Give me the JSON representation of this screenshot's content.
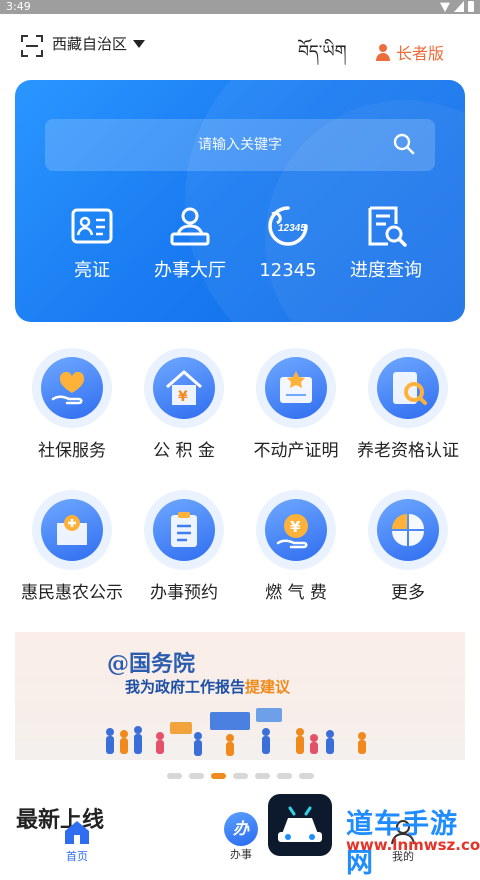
{
  "status_bar": {
    "time": "3:49"
  },
  "header": {
    "region": "西藏自治区",
    "tibetan_label": "བོད་ཡིག",
    "elder_mode": "长者版"
  },
  "search": {
    "placeholder": "请输入关键字"
  },
  "quick_actions": [
    {
      "label": "亮证",
      "icon": "id-card-icon"
    },
    {
      "label": "办事大厅",
      "icon": "service-hall-icon"
    },
    {
      "label": "12345",
      "icon": "hotline-12345-icon"
    },
    {
      "label": "进度查询",
      "icon": "progress-search-icon"
    }
  ],
  "hotline_icon_text": "12345",
  "services": [
    {
      "label": "社保服务",
      "icon": "heart-hand-icon"
    },
    {
      "label": "公 积 金",
      "icon": "housing-fund-icon"
    },
    {
      "label": "不动产证明",
      "icon": "property-certificate-icon"
    },
    {
      "label": "养老资格认证",
      "icon": "pension-verify-icon"
    },
    {
      "label": "惠民惠农公示",
      "icon": "benefit-notice-icon"
    },
    {
      "label": "办事预约",
      "icon": "appointment-icon"
    },
    {
      "label": "燃 气 费",
      "icon": "gas-fee-icon"
    },
    {
      "label": "更多",
      "icon": "more-icon"
    }
  ],
  "banner": {
    "title": "@国务院",
    "subtitle": "我为政府工作报告",
    "highlight": "提建议"
  },
  "carousel": {
    "count": 7,
    "active_index": 2
  },
  "section": {
    "title": "最新上线"
  },
  "bottom_nav": {
    "home": "首页",
    "ban_icon_text": "办",
    "ban": "办事",
    "mine": "我的"
  },
  "watermark": {
    "text": "道车手游网",
    "url": "www.lnmwsz.com"
  },
  "colors": {
    "brand_blue": "#1a7cf2",
    "accent_orange": "#f08a1c",
    "elder_orange": "#ee6b3b"
  }
}
